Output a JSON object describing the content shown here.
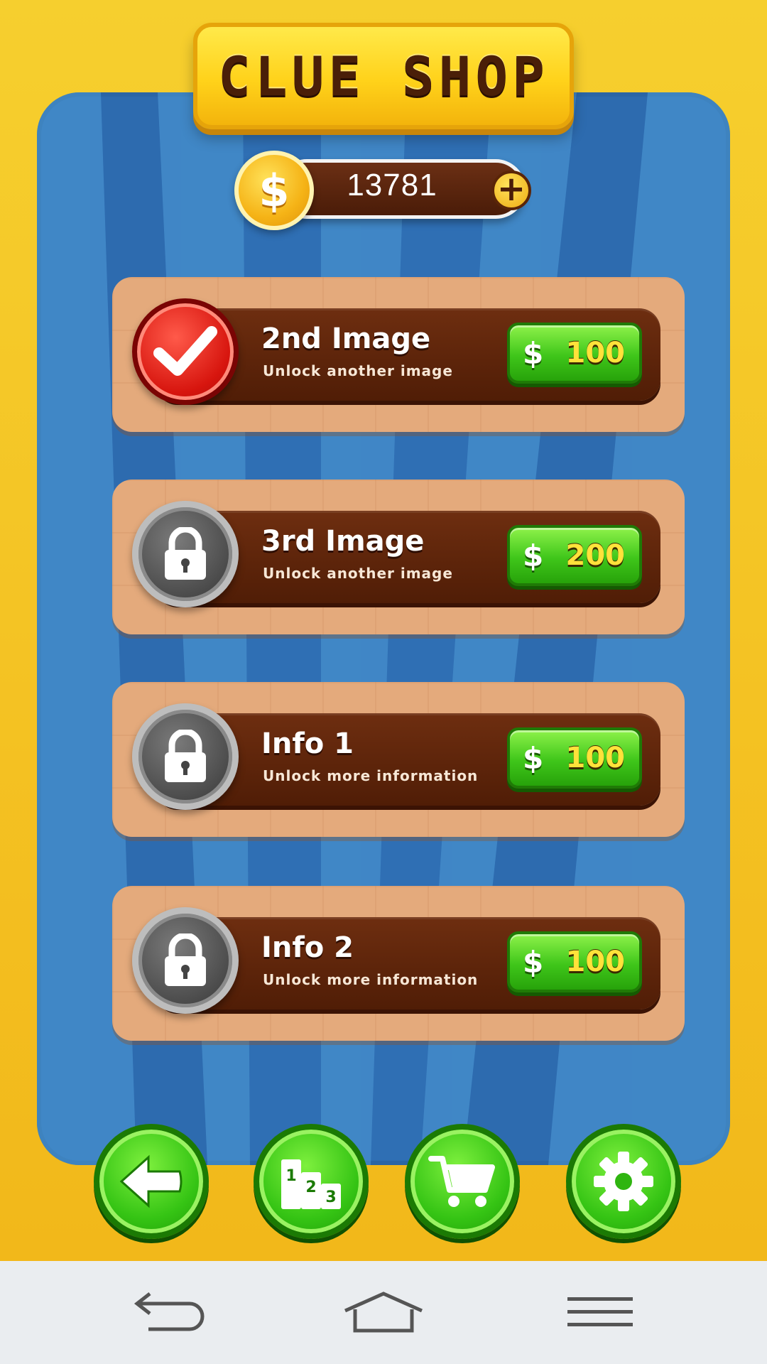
{
  "shop": {
    "title": "CLUE SHOP",
    "coins": "13781",
    "currency_symbol": "$"
  },
  "items": [
    {
      "title": "2nd Image",
      "description": "Unlock another image",
      "price": "100",
      "state": "unlocked"
    },
    {
      "title": "3rd Image",
      "description": "Unlock another image",
      "price": "200",
      "state": "locked"
    },
    {
      "title": "Info 1",
      "description": "Unlock more information",
      "price": "100",
      "state": "locked"
    },
    {
      "title": "Info 2",
      "description": "Unlock more information",
      "price": "100",
      "state": "locked"
    }
  ],
  "toolbar": {
    "buttons": [
      "back-arrow-icon",
      "leaderboard-podium-icon",
      "shopping-cart-icon",
      "gear-icon"
    ]
  },
  "system_nav": {
    "buttons": [
      "back-icon",
      "home-icon",
      "menu-icon"
    ]
  },
  "colors": {
    "gold": "#f4c21a",
    "blue": "#2f6fb4",
    "green_button": "#3fc61a",
    "brown_strip": "#5a2208",
    "card_tan": "#e4aa7c"
  }
}
